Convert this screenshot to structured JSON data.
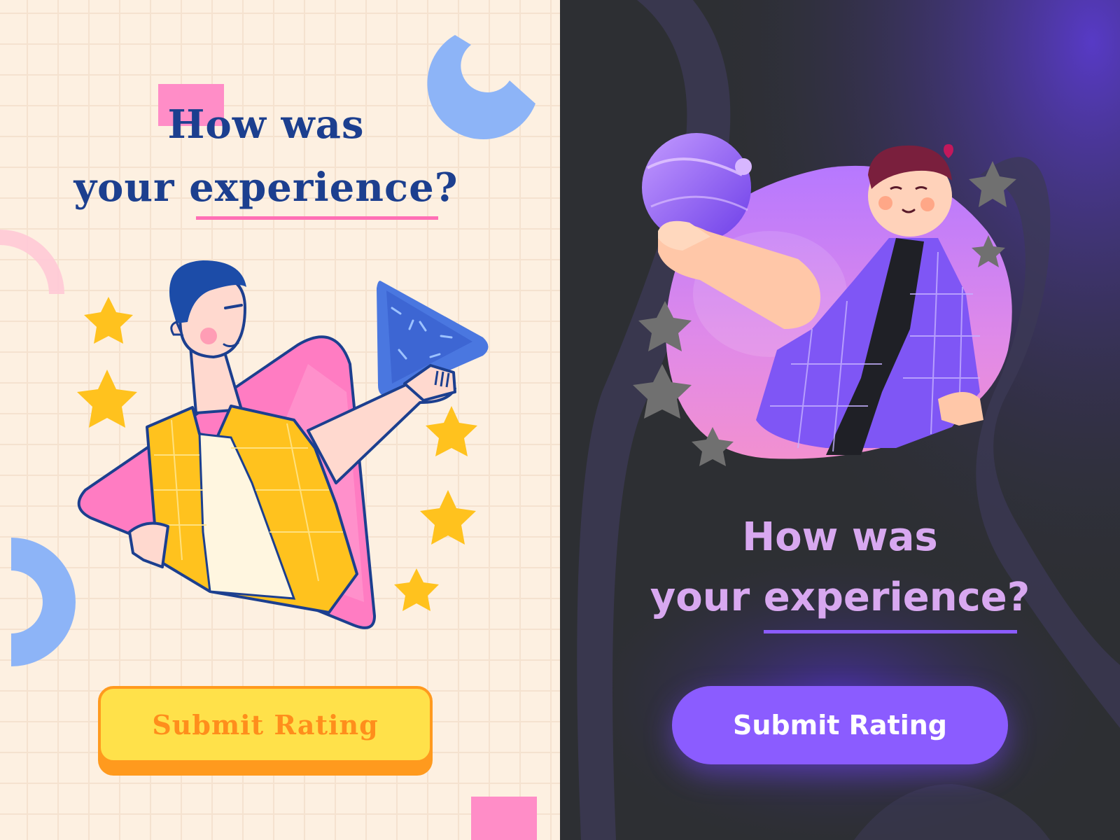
{
  "light_card": {
    "question_line1": "How was",
    "question_line2_start": "your",
    "question_line2_emphasis": "experience?",
    "submit_label": "Submit Rating",
    "colors": {
      "background": "#fdf0e1",
      "title": "#1c3f8f",
      "underline": "#ff6fb5",
      "button_fill": "#ffe14a",
      "button_border": "#ff9a1e",
      "button_text": "#ff8e1c"
    }
  },
  "dark_card": {
    "question_line1": "How was",
    "question_line2_start": "your",
    "question_line2_emphasis": "experience?",
    "submit_label": "Submit Rating",
    "colors": {
      "background": "#2d2f33",
      "title": "#d8a8f0",
      "underline": "#8b5cff",
      "button_fill": "#8b5cff",
      "button_text": "#ffffff"
    }
  },
  "icons": [
    "star-icon",
    "play-triangle-icon",
    "planet-icon",
    "heart-icon"
  ]
}
